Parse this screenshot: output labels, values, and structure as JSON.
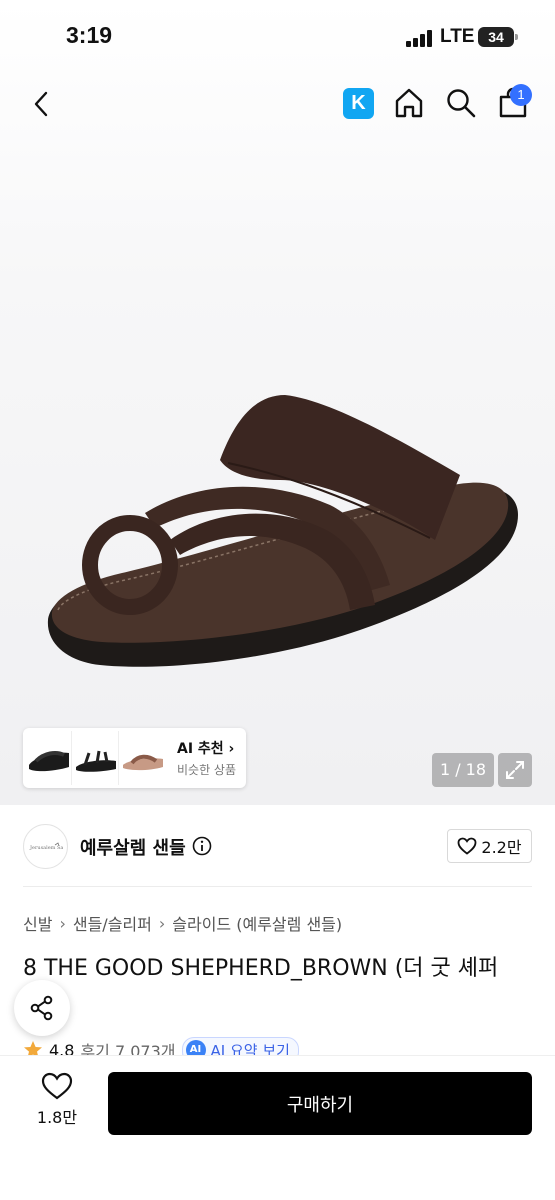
{
  "status_bar": {
    "time": "3:19",
    "network": "LTE",
    "battery": "34"
  },
  "header": {
    "back_icon": "chevron-left-icon",
    "k_label": "K",
    "home_icon": "home-icon",
    "search_icon": "search-icon",
    "cart_icon": "shopping-bag-icon",
    "cart_badge": "1"
  },
  "gallery": {
    "ai_card": {
      "title": "AI 추천",
      "subtitle": "비슷한 상품"
    },
    "counter": "1 / 18"
  },
  "brand": {
    "name": "예루살렘 샌들",
    "like_count": "2.2만"
  },
  "breadcrumb": [
    "신발",
    "샌들/슬리퍼",
    "슬라이드 (예루살렘 샌들)"
  ],
  "product": {
    "title": "8 THE GOOD SHEPHERD_BROWN (더 굿 셰퍼",
    "rating": "4.8",
    "reviews": "후기 7,073개",
    "ai_badge": "AI",
    "ai_summary": "AI 요약 보기"
  },
  "bottom_bar": {
    "wish_count": "1.8만",
    "buy_label": "구매하기"
  },
  "colors": {
    "accent_blue": "#3370ff",
    "k_blue": "#11a6f2",
    "buy_button": "#000000",
    "star": "#f2a93b"
  }
}
